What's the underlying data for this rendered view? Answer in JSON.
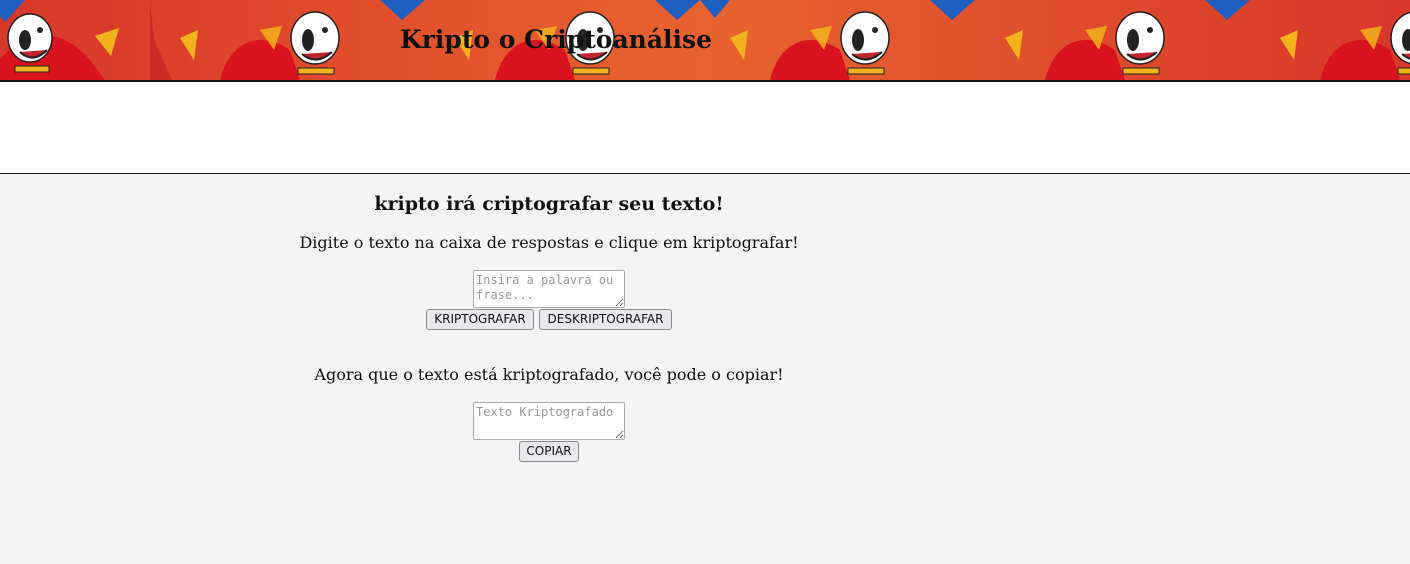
{
  "header": {
    "title": "Kripto o Criptoanálise",
    "banner_image": "krypto-superdog-banner"
  },
  "main": {
    "heading": "kripto irá criptografar seu texto!",
    "instruction": "Digite o texto na caixa de respostas e clique em kriptografar!",
    "input": {
      "value": "",
      "placeholder": "Insira a palavra ou frase..."
    },
    "buttons": {
      "encrypt_label": "KRIPTOGRAFAR",
      "decrypt_label": "DESKRIPTOGRAFAR",
      "copy_label": "COPIAR"
    },
    "output_instruction": "Agora que o texto está kriptografado, você pode o copiar!",
    "output": {
      "value": "",
      "placeholder": "Texto Kriptografado"
    }
  },
  "colors": {
    "banner_red": "#d8372a",
    "banner_orange": "#e8632f",
    "cape_red": "#d9141f",
    "accent_yellow": "#f2b21c",
    "corner_blue": "#1f5fbf",
    "background": "#f4f4f4"
  }
}
